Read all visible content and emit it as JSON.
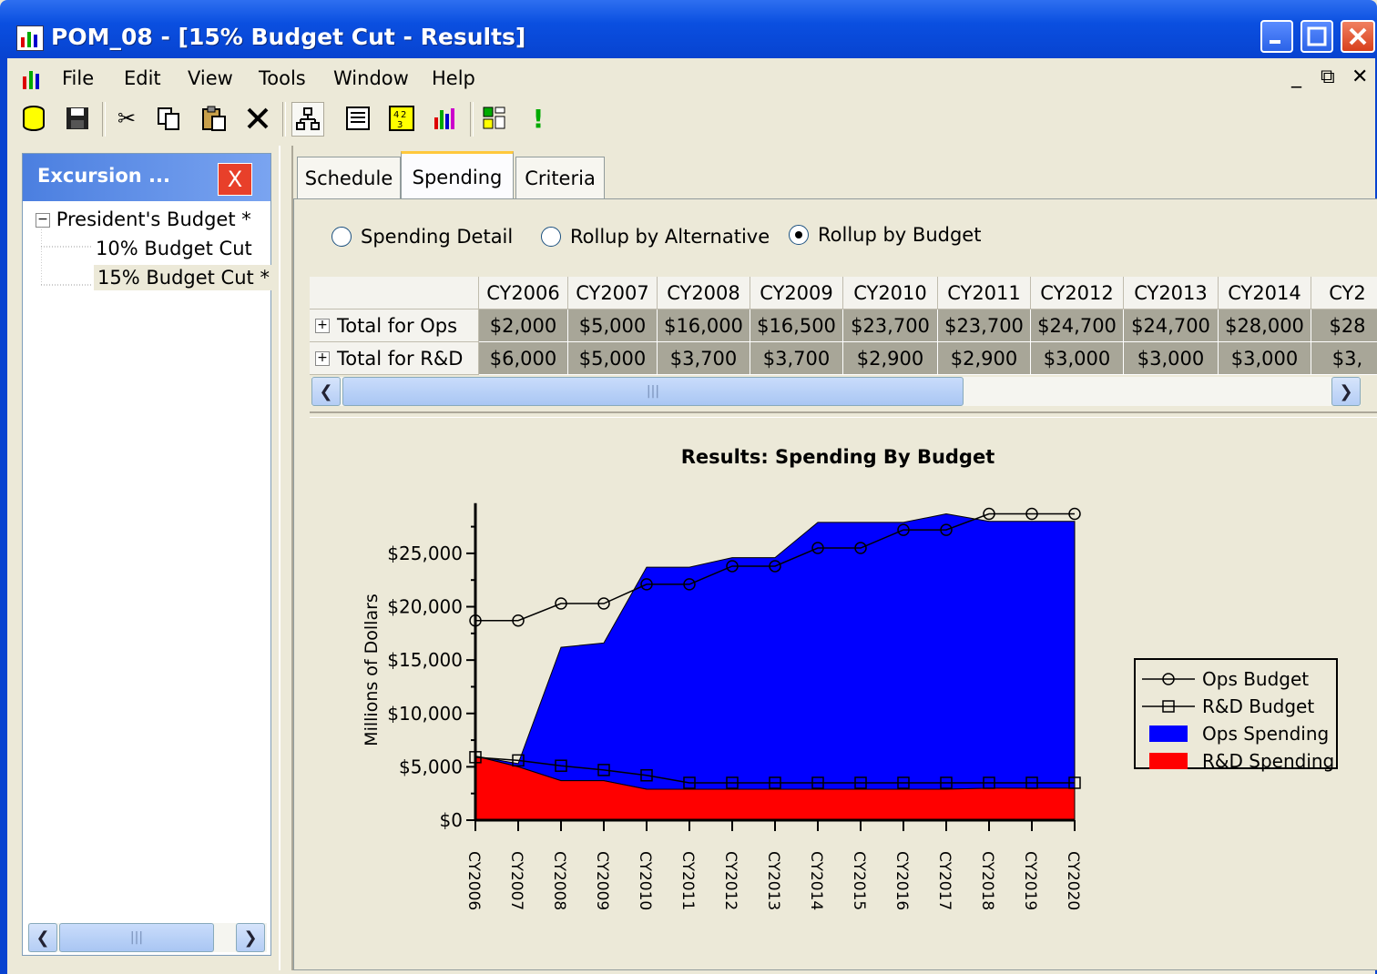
{
  "window": {
    "title": "POM_08 - [15% Budget Cut - Results]"
  },
  "menu": [
    "File",
    "Edit",
    "View",
    "Tools",
    "Window",
    "Help"
  ],
  "mdi_controls": [
    "_",
    "⧉",
    "✕"
  ],
  "toolbar": [
    "database-icon",
    "save-icon",
    "cut-icon",
    "copy-icon",
    "paste-icon",
    "delete-icon",
    "tree-icon",
    "list-icon",
    "calc-icon",
    "chart-icon",
    "blocks-icon",
    "run-icon"
  ],
  "left_panel": {
    "title": "Excursion ...",
    "close_label": "X",
    "tree": [
      {
        "label": "President's Budget *",
        "level": 0,
        "expander": "−"
      },
      {
        "label": "10% Budget Cut",
        "level": 1
      },
      {
        "label": "15% Budget Cut *",
        "level": 1,
        "selected": true
      }
    ]
  },
  "tabs": [
    {
      "label": "Schedule"
    },
    {
      "label": "Spending",
      "active": true
    },
    {
      "label": "Criteria"
    }
  ],
  "radios": [
    {
      "label": "Spending Detail",
      "checked": false
    },
    {
      "label": "Rollup by Alternative",
      "checked": false
    },
    {
      "label": "Rollup by Budget",
      "checked": true
    }
  ],
  "table": {
    "columns": [
      "CY2006",
      "CY2007",
      "CY2008",
      "CY2009",
      "CY2010",
      "CY2011",
      "CY2012",
      "CY2013",
      "CY2014",
      "CY2"
    ],
    "rows": [
      {
        "label": "Total for Ops",
        "values": [
          "$2,000",
          "$5,000",
          "$16,000",
          "$16,500",
          "$23,700",
          "$23,700",
          "$24,700",
          "$24,700",
          "$28,000",
          "$28"
        ]
      },
      {
        "label": "Total for R&D",
        "values": [
          "$6,000",
          "$5,000",
          "$3,700",
          "$3,700",
          "$2,900",
          "$2,900",
          "$3,000",
          "$3,000",
          "$3,000",
          "$3,"
        ]
      }
    ]
  },
  "chart_data": {
    "type": "area",
    "title": "Results:  Spending By Budget",
    "ylabel": "Millions of Dollars",
    "ylim": [
      0,
      29000
    ],
    "yticks": [
      0,
      5000,
      10000,
      15000,
      20000,
      25000
    ],
    "ytick_labels": [
      "$0",
      "$5,000",
      "$10,000",
      "$15,000",
      "$20,000",
      "$25,000"
    ],
    "categories": [
      "CY2006",
      "CY2007",
      "CY2008",
      "CY2009",
      "CY2010",
      "CY2011",
      "CY2012",
      "CY2013",
      "CY2014",
      "CY2015",
      "CY2016",
      "CY2017",
      "CY2018",
      "CY2019",
      "CY2020"
    ],
    "series": [
      {
        "name": "Ops Budget",
        "kind": "line",
        "marker": "circle",
        "color": "#000000",
        "values": [
          18700,
          18700,
          20300,
          20300,
          22100,
          22100,
          23800,
          23800,
          25500,
          25500,
          27200,
          27200,
          28700,
          28700,
          28700
        ]
      },
      {
        "name": "R&D Budget",
        "kind": "line",
        "marker": "square",
        "color": "#000000",
        "values": [
          5900,
          5600,
          5100,
          4700,
          4200,
          3500,
          3500,
          3500,
          3500,
          3500,
          3500,
          3500,
          3500,
          3500,
          3500
        ]
      },
      {
        "name": "Ops Spending",
        "kind": "area",
        "color": "#0000ff",
        "values": [
          0,
          300,
          12500,
          12900,
          20800,
          20800,
          21700,
          21700,
          25000,
          25000,
          25000,
          25800,
          25000,
          25000,
          25000
        ]
      },
      {
        "name": "R&D Spending",
        "kind": "area",
        "color": "#ff0000",
        "values": [
          6000,
          5000,
          3700,
          3700,
          2900,
          2900,
          2900,
          2900,
          2900,
          2900,
          2900,
          2900,
          3000,
          3000,
          3000
        ]
      }
    ],
    "legend": "right"
  }
}
